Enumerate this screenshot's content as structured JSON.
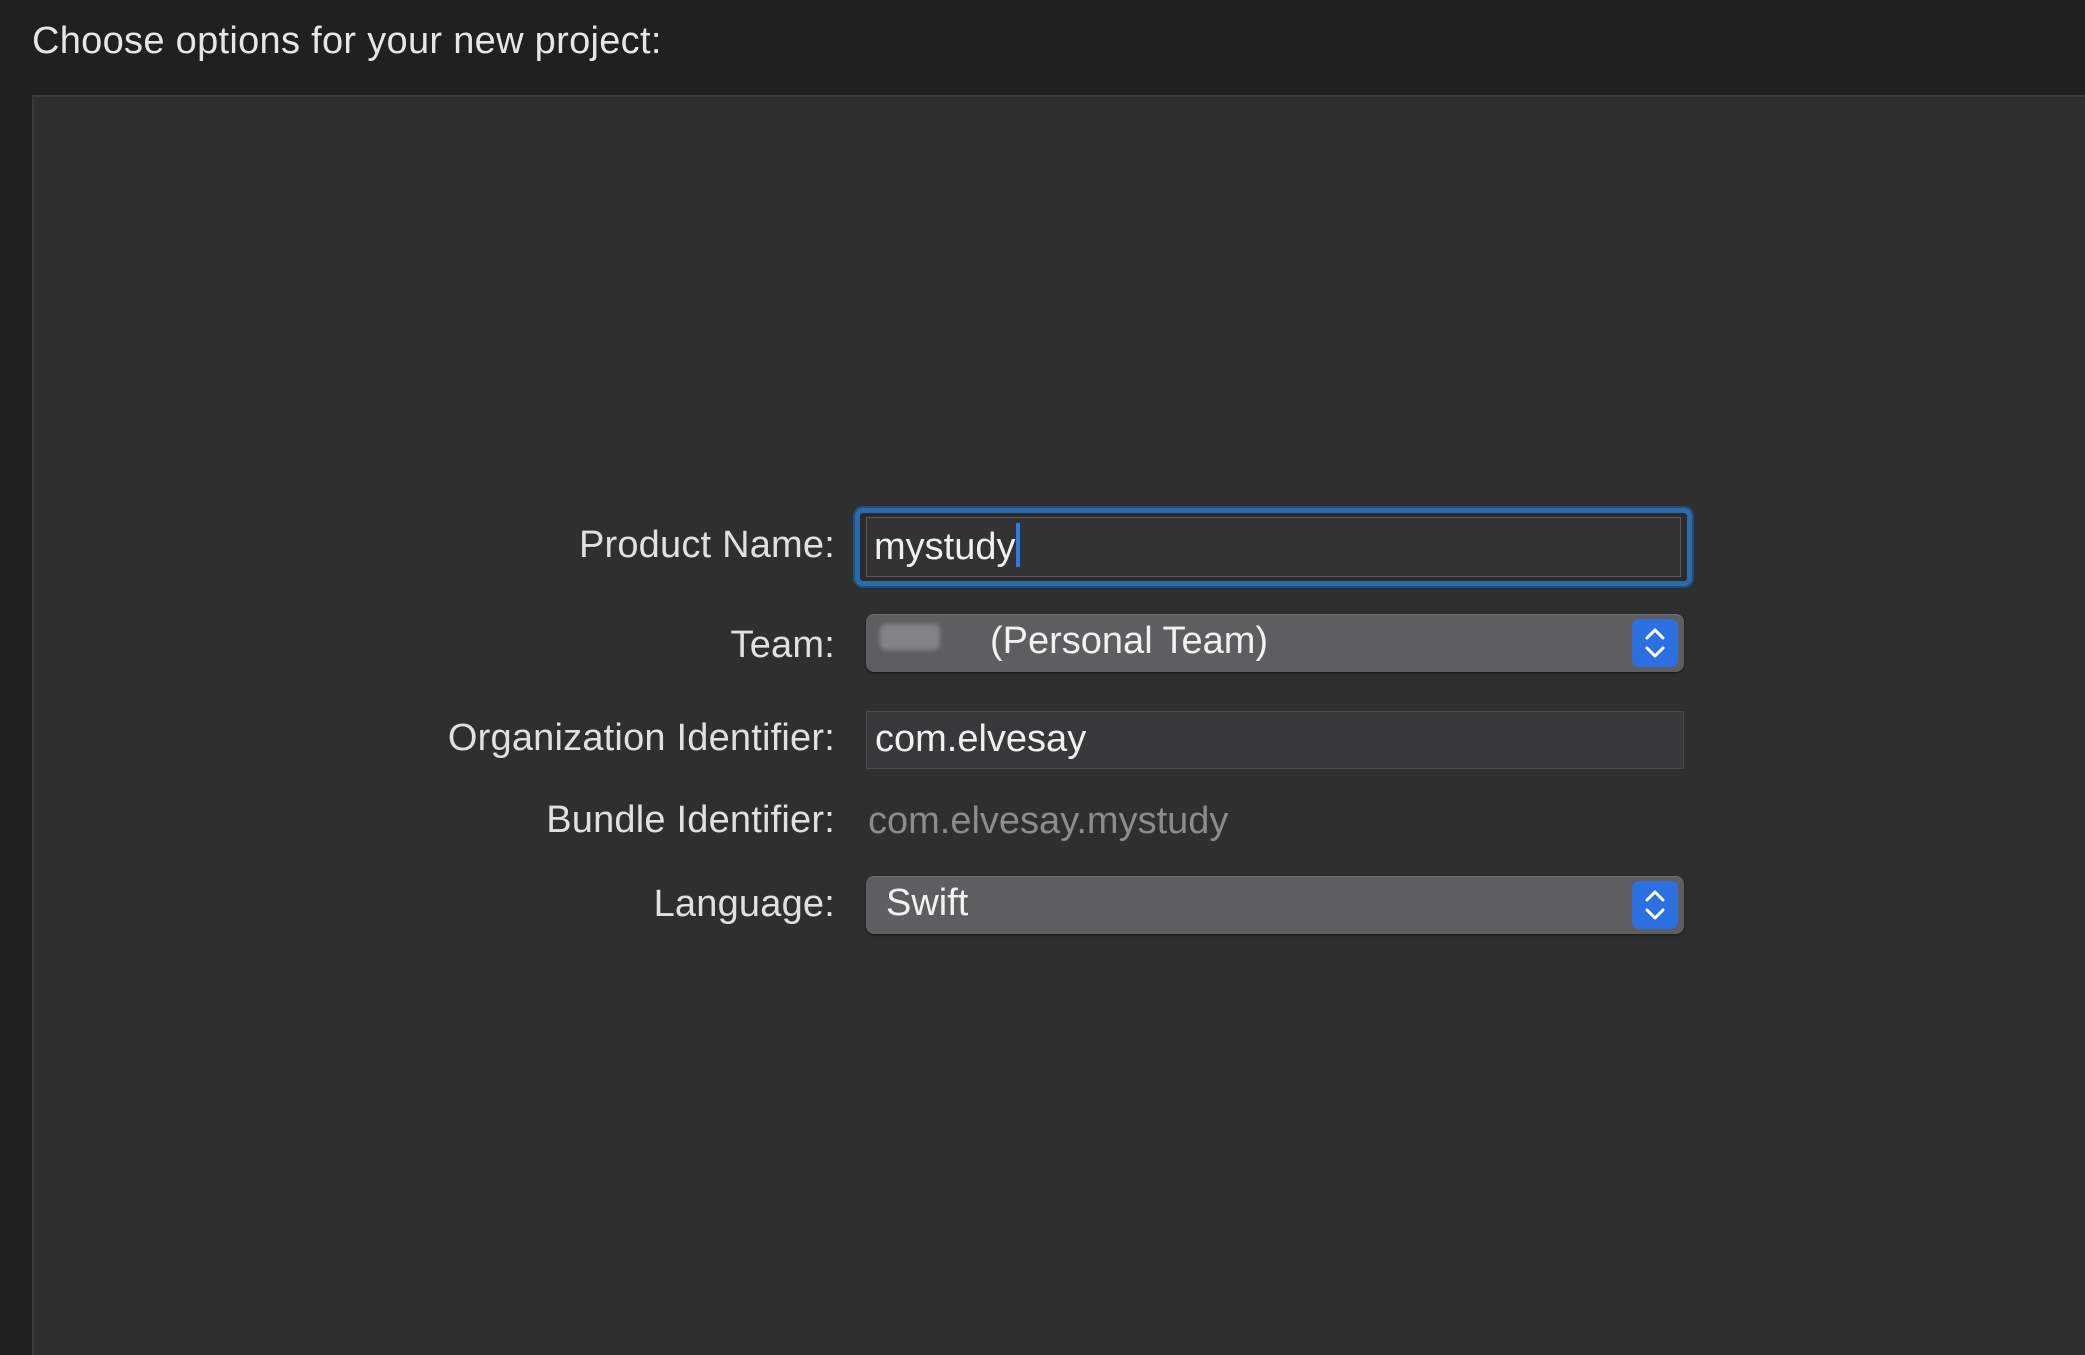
{
  "header": {
    "title": "Choose options for your new project:"
  },
  "form": {
    "product_name": {
      "label": "Product Name:",
      "value": "mystudy"
    },
    "team": {
      "label": "Team:",
      "value": "(Personal Team)"
    },
    "organization_identifier": {
      "label": "Organization Identifier:",
      "value": "com.elvesay"
    },
    "bundle_identifier": {
      "label": "Bundle Identifier:",
      "value": "com.elvesay.mystudy"
    },
    "language": {
      "label": "Language:",
      "value": "Swift"
    }
  },
  "icons": {
    "popup_stepper": "chevron-up-down-icon"
  },
  "colors": {
    "accent": "#2c6fe0",
    "focus_ring": "#2f6aa8",
    "panel_background": "#2f2f30",
    "window_background": "#202020"
  }
}
